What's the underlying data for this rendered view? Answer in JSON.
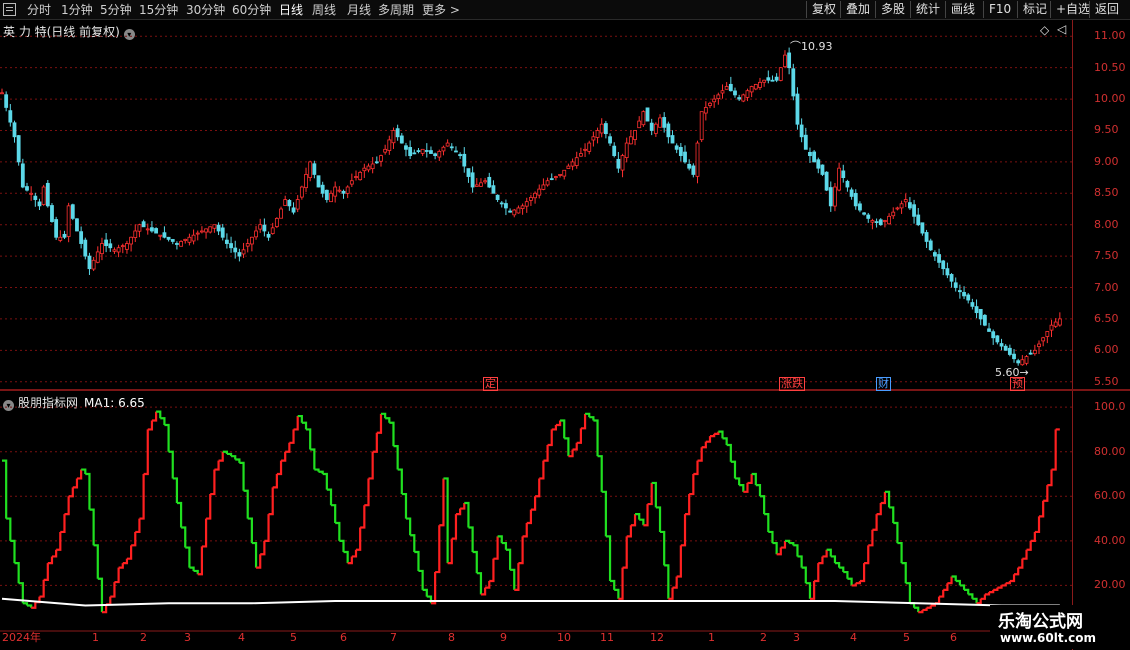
{
  "toolbar": {
    "periods": [
      "分时",
      "1分钟",
      "5分钟",
      "15分钟",
      "30分钟",
      "60分钟",
      "日线",
      "周线",
      "月线",
      "多周期",
      "更多 >"
    ],
    "active_period": "日线",
    "right_buttons": [
      "复权",
      "叠加",
      "多股",
      "统计",
      "画线",
      "F10",
      "标记",
      "+自选",
      "返回"
    ]
  },
  "main_chart": {
    "title": "英 力 特(日线 前复权)",
    "y_ticks": [
      "11.00",
      "10.50",
      "10.00",
      "9.50",
      "9.00",
      "8.50",
      "8.00",
      "7.50",
      "7.00",
      "6.50",
      "6.00",
      "5.50"
    ],
    "high_label": "10.93",
    "low_label": "5.60",
    "events": [
      {
        "text": "定",
        "color": "#ff4040"
      },
      {
        "text": "涨跌",
        "color": "#ff4040"
      },
      {
        "text": "财",
        "color": "#4a9cff"
      },
      {
        "text": "预",
        "color": "#ff4040"
      }
    ]
  },
  "indicator": {
    "title": "股朋指标网",
    "ma_text": "MA1: 6.65",
    "y_ticks": [
      "100.0",
      "80.00",
      "60.00",
      "40.00",
      "20.00"
    ]
  },
  "x_axis": {
    "labels": [
      "2024年",
      "1",
      "2",
      "3",
      "4",
      "5",
      "6",
      "7",
      "8",
      "9",
      "10",
      "11",
      "12",
      "1",
      "2",
      "3",
      "4",
      "5",
      "6"
    ]
  },
  "watermark": {
    "line1": "乐淘公式网",
    "line2": "www.60lt.com"
  },
  "chart_data": [
    {
      "type": "candlestick",
      "title": "英 力 特(日线 前复权)",
      "ylim": [
        5.4,
        11.1
      ],
      "y_ticks": [
        5.5,
        6.0,
        6.5,
        7.0,
        7.5,
        8.0,
        8.5,
        9.0,
        9.5,
        10.0,
        10.5,
        11.0
      ],
      "x_labels": [
        "2024年",
        "1",
        "2",
        "3",
        "4",
        "5",
        "6",
        "7",
        "8",
        "9",
        "10",
        "11",
        "12",
        "1",
        "2",
        "3",
        "4",
        "5",
        "6"
      ],
      "close_path": [
        [
          0,
          10.1
        ],
        [
          3,
          9.4
        ],
        [
          5,
          8.6
        ],
        [
          7,
          8.5
        ],
        [
          9,
          8.3
        ],
        [
          10,
          8.6
        ],
        [
          11,
          8.3
        ],
        [
          13,
          7.8
        ],
        [
          15,
          7.8
        ],
        [
          16,
          8.3
        ],
        [
          18,
          7.9
        ],
        [
          21,
          7.3
        ],
        [
          24,
          7.7
        ],
        [
          27,
          7.6
        ],
        [
          30,
          7.7
        ],
        [
          33,
          8.0
        ],
        [
          36,
          7.9
        ],
        [
          39,
          7.8
        ],
        [
          42,
          7.7
        ],
        [
          45,
          7.8
        ],
        [
          48,
          7.9
        ],
        [
          51,
          8.0
        ],
        [
          54,
          7.7
        ],
        [
          57,
          7.5
        ],
        [
          60,
          7.8
        ],
        [
          62,
          8.0
        ],
        [
          64,
          7.8
        ],
        [
          66,
          8.1
        ],
        [
          68,
          8.4
        ],
        [
          70,
          8.2
        ],
        [
          72,
          8.6
        ],
        [
          74,
          9.0
        ],
        [
          76,
          8.6
        ],
        [
          78,
          8.4
        ],
        [
          80,
          8.6
        ],
        [
          82,
          8.5
        ],
        [
          84,
          8.7
        ],
        [
          87,
          8.9
        ],
        [
          90,
          9.0
        ],
        [
          92,
          9.2
        ],
        [
          94,
          9.5
        ],
        [
          96,
          9.3
        ],
        [
          98,
          9.1
        ],
        [
          101,
          9.2
        ],
        [
          104,
          9.1
        ],
        [
          107,
          9.3
        ],
        [
          110,
          9.1
        ],
        [
          113,
          8.6
        ],
        [
          116,
          8.7
        ],
        [
          119,
          8.4
        ],
        [
          122,
          8.2
        ],
        [
          125,
          8.3
        ],
        [
          128,
          8.5
        ],
        [
          131,
          8.7
        ],
        [
          134,
          8.8
        ],
        [
          137,
          9.0
        ],
        [
          140,
          9.2
        ],
        [
          142,
          9.4
        ],
        [
          144,
          9.6
        ],
        [
          146,
          9.3
        ],
        [
          148,
          8.9
        ],
        [
          150,
          9.3
        ],
        [
          152,
          9.5
        ],
        [
          154,
          9.8
        ],
        [
          156,
          9.5
        ],
        [
          158,
          9.7
        ],
        [
          160,
          9.4
        ],
        [
          162,
          9.2
        ],
        [
          164,
          9.0
        ],
        [
          166,
          8.8
        ],
        [
          168,
          9.8
        ],
        [
          171,
          10.0
        ],
        [
          174,
          10.2
        ],
        [
          177,
          10.0
        ],
        [
          180,
          10.2
        ],
        [
          183,
          10.3
        ],
        [
          186,
          10.3
        ],
        [
          188,
          10.7
        ],
        [
          189,
          10.5
        ],
        [
          191,
          9.6
        ],
        [
          193,
          9.2
        ],
        [
          195,
          9.0
        ],
        [
          197,
          8.8
        ],
        [
          199,
          8.3
        ],
        [
          201,
          8.9
        ],
        [
          203,
          8.6
        ],
        [
          205,
          8.3
        ],
        [
          208,
          8.1
        ],
        [
          211,
          8.0
        ],
        [
          214,
          8.2
        ],
        [
          217,
          8.4
        ],
        [
          220,
          8.0
        ],
        [
          223,
          7.6
        ],
        [
          226,
          7.3
        ],
        [
          229,
          7.0
        ],
        [
          232,
          6.8
        ],
        [
          235,
          6.5
        ],
        [
          238,
          6.2
        ],
        [
          241,
          6.0
        ],
        [
          244,
          5.8
        ],
        [
          246,
          5.9
        ],
        [
          248,
          6.0
        ],
        [
          250,
          6.2
        ],
        [
          252,
          6.4
        ],
        [
          254,
          6.5
        ]
      ],
      "high_marker": 10.93,
      "low_marker": 5.6
    },
    {
      "type": "line",
      "title": "股朋指标网",
      "ylim": [
        0,
        105
      ],
      "y_ticks": [
        20,
        40,
        60,
        80,
        100
      ],
      "ma1": 6.65,
      "series": [
        {
          "values": [
            [
              0,
              76
            ],
            [
              1,
              50
            ],
            [
              3,
              30
            ],
            [
              5,
              12
            ],
            [
              7,
              10
            ],
            [
              9,
              15
            ],
            [
              11,
              30
            ],
            [
              13,
              36
            ],
            [
              16,
              60
            ],
            [
              19,
              72
            ],
            [
              20,
              70
            ],
            [
              22,
              38
            ],
            [
              24,
              8
            ],
            [
              26,
              15
            ],
            [
              28,
              28
            ],
            [
              30,
              32
            ],
            [
              33,
              50
            ],
            [
              35,
              90
            ],
            [
              37,
              98
            ],
            [
              39,
              92
            ],
            [
              41,
              68
            ],
            [
              43,
              46
            ],
            [
              45,
              28
            ],
            [
              47,
              25
            ],
            [
              49,
              50
            ],
            [
              51,
              72
            ],
            [
              53,
              80
            ],
            [
              55,
              78
            ],
            [
              57,
              75
            ],
            [
              59,
              50
            ],
            [
              61,
              28
            ],
            [
              63,
              40
            ],
            [
              65,
              64
            ],
            [
              67,
              76
            ],
            [
              69,
              84
            ],
            [
              71,
              96
            ],
            [
              73,
              90
            ],
            [
              75,
              72
            ],
            [
              77,
              70
            ],
            [
              79,
              56
            ],
            [
              81,
              40
            ],
            [
              83,
              30
            ],
            [
              85,
              36
            ],
            [
              87,
              56
            ],
            [
              89,
              80
            ],
            [
              91,
              97
            ],
            [
              93,
              93
            ],
            [
              95,
              72
            ],
            [
              97,
              50
            ],
            [
              99,
              35
            ],
            [
              101,
              18
            ],
            [
              103,
              12
            ],
            [
              104,
              26
            ],
            [
              106,
              68
            ],
            [
              107,
              30
            ],
            [
              109,
              52
            ],
            [
              111,
              57
            ],
            [
              113,
              35
            ],
            [
              115,
              16
            ],
            [
              117,
              22
            ],
            [
              119,
              42
            ],
            [
              121,
              36
            ],
            [
              123,
              18
            ],
            [
              125,
              42
            ],
            [
              128,
              60
            ],
            [
              130,
              76
            ],
            [
              132,
              90
            ],
            [
              134,
              94
            ],
            [
              136,
              78
            ],
            [
              138,
              84
            ],
            [
              140,
              97
            ],
            [
              142,
              94
            ],
            [
              144,
              62
            ],
            [
              146,
              22
            ],
            [
              148,
              14
            ],
            [
              150,
              42
            ],
            [
              152,
              52
            ],
            [
              154,
              47
            ],
            [
              156,
              66
            ],
            [
              158,
              44
            ],
            [
              160,
              14
            ],
            [
              162,
              24
            ],
            [
              164,
              52
            ],
            [
              166,
              70
            ],
            [
              168,
              82
            ],
            [
              170,
              87
            ],
            [
              172,
              89
            ],
            [
              174,
              83
            ],
            [
              176,
              68
            ],
            [
              178,
              62
            ],
            [
              180,
              70
            ],
            [
              182,
              60
            ],
            [
              184,
              44
            ],
            [
              186,
              34
            ],
            [
              188,
              40
            ],
            [
              190,
              38
            ],
            [
              192,
              28
            ],
            [
              194,
              14
            ],
            [
              196,
              30
            ],
            [
              198,
              36
            ],
            [
              200,
              30
            ],
            [
              202,
              26
            ],
            [
              204,
              20
            ],
            [
              206,
              22
            ],
            [
              208,
              38
            ],
            [
              210,
              52
            ],
            [
              212,
              62
            ],
            [
              214,
              48
            ],
            [
              216,
              30
            ],
            [
              218,
              12
            ],
            [
              220,
              8
            ],
            [
              222,
              10
            ],
            [
              224,
              12
            ],
            [
              226,
              18
            ],
            [
              228,
              24
            ],
            [
              230,
              20
            ],
            [
              232,
              16
            ],
            [
              234,
              12
            ],
            [
              236,
              16
            ],
            [
              238,
              18
            ],
            [
              240,
              20
            ],
            [
              242,
              22
            ],
            [
              244,
              28
            ],
            [
              246,
              36
            ],
            [
              248,
              44
            ],
            [
              250,
              58
            ],
            [
              252,
              72
            ],
            [
              253,
              90
            ]
          ],
          "color_up": "#ff2020",
          "color_down": "#20e020"
        },
        {
          "values": [
            [
              0,
              14
            ],
            [
              20,
              11
            ],
            [
              40,
              12
            ],
            [
              60,
              12
            ],
            [
              80,
              13
            ],
            [
              100,
              13
            ],
            [
              120,
              13
            ],
            [
              140,
              13
            ],
            [
              160,
              13
            ],
            [
              180,
              13
            ],
            [
              200,
              13
            ],
            [
              220,
              12
            ],
            [
              240,
              11
            ],
            [
              254,
              11
            ]
          ],
          "color": "#ffffff"
        }
      ]
    }
  ]
}
